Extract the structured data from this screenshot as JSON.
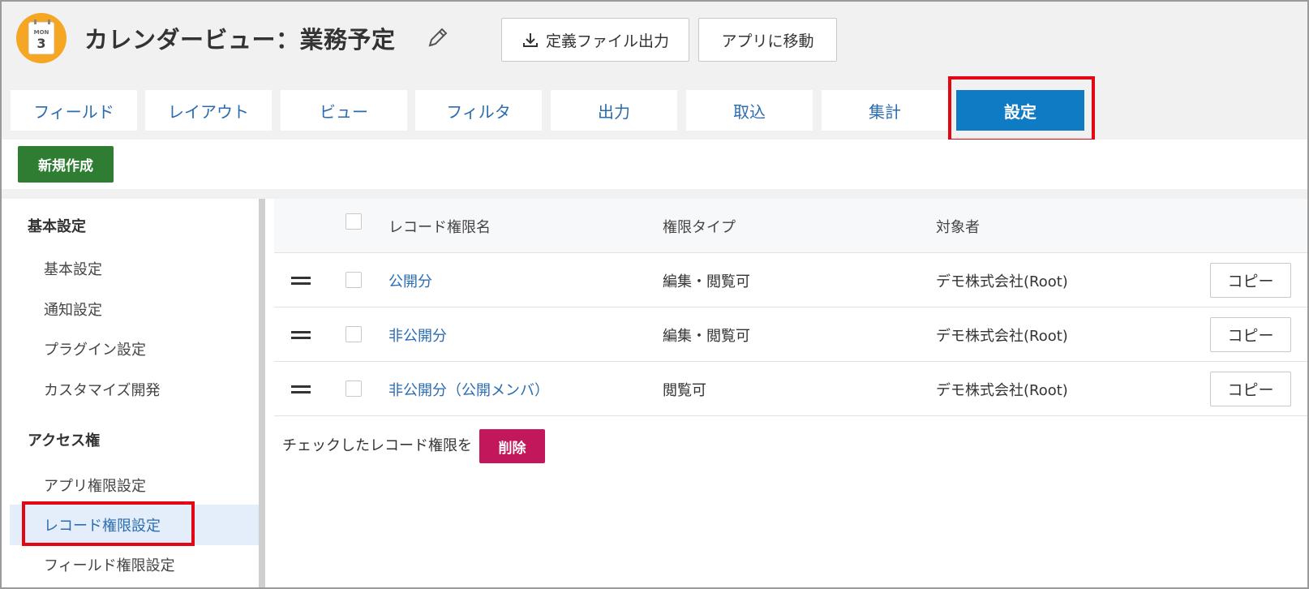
{
  "header": {
    "app_icon_month": "MON",
    "app_icon_day": "3",
    "title": "カレンダービュー：業務予定",
    "export_label": "定義ファイル出力",
    "goto_app_label": "アプリに移動"
  },
  "tabs": [
    {
      "label": "フィールド"
    },
    {
      "label": "レイアウト"
    },
    {
      "label": "ビュー"
    },
    {
      "label": "フィルタ"
    },
    {
      "label": "出力"
    },
    {
      "label": "取込"
    },
    {
      "label": "集計"
    },
    {
      "label": "設定",
      "active": true
    }
  ],
  "actions": {
    "new_label": "新規作成"
  },
  "sidebar": {
    "sections": [
      {
        "heading": "基本設定",
        "items": [
          "基本設定",
          "通知設定",
          "プラグイン設定",
          "カスタマイズ開発"
        ]
      },
      {
        "heading": "アクセス権",
        "items": [
          "アプリ権限設定",
          "レコード権限設定",
          "フィールド権限設定"
        ]
      }
    ],
    "active_item": "レコード権限設定"
  },
  "table": {
    "columns": [
      "レコード権限名",
      "権限タイプ",
      "対象者"
    ],
    "rows": [
      {
        "name": "公開分",
        "type": "編集・閲覧可",
        "target": "デモ株式会社(Root)",
        "copy_label": "コピー"
      },
      {
        "name": "非公開分",
        "type": "編集・閲覧可",
        "target": "デモ株式会社(Root)",
        "copy_label": "コピー"
      },
      {
        "name": "非公開分（公開メンバ）",
        "type": "閲覧可",
        "target": "デモ株式会社(Root)",
        "copy_label": "コピー"
      }
    ]
  },
  "bulk": {
    "text": "チェックしたレコード権限を",
    "delete_label": "削除"
  },
  "colors": {
    "active_tab": "#0f7bc4",
    "new_button": "#2e7d32",
    "delete_button": "#c2185b",
    "highlight": "#e30613",
    "link": "#2b6cb0",
    "app_icon": "#f5a623"
  }
}
